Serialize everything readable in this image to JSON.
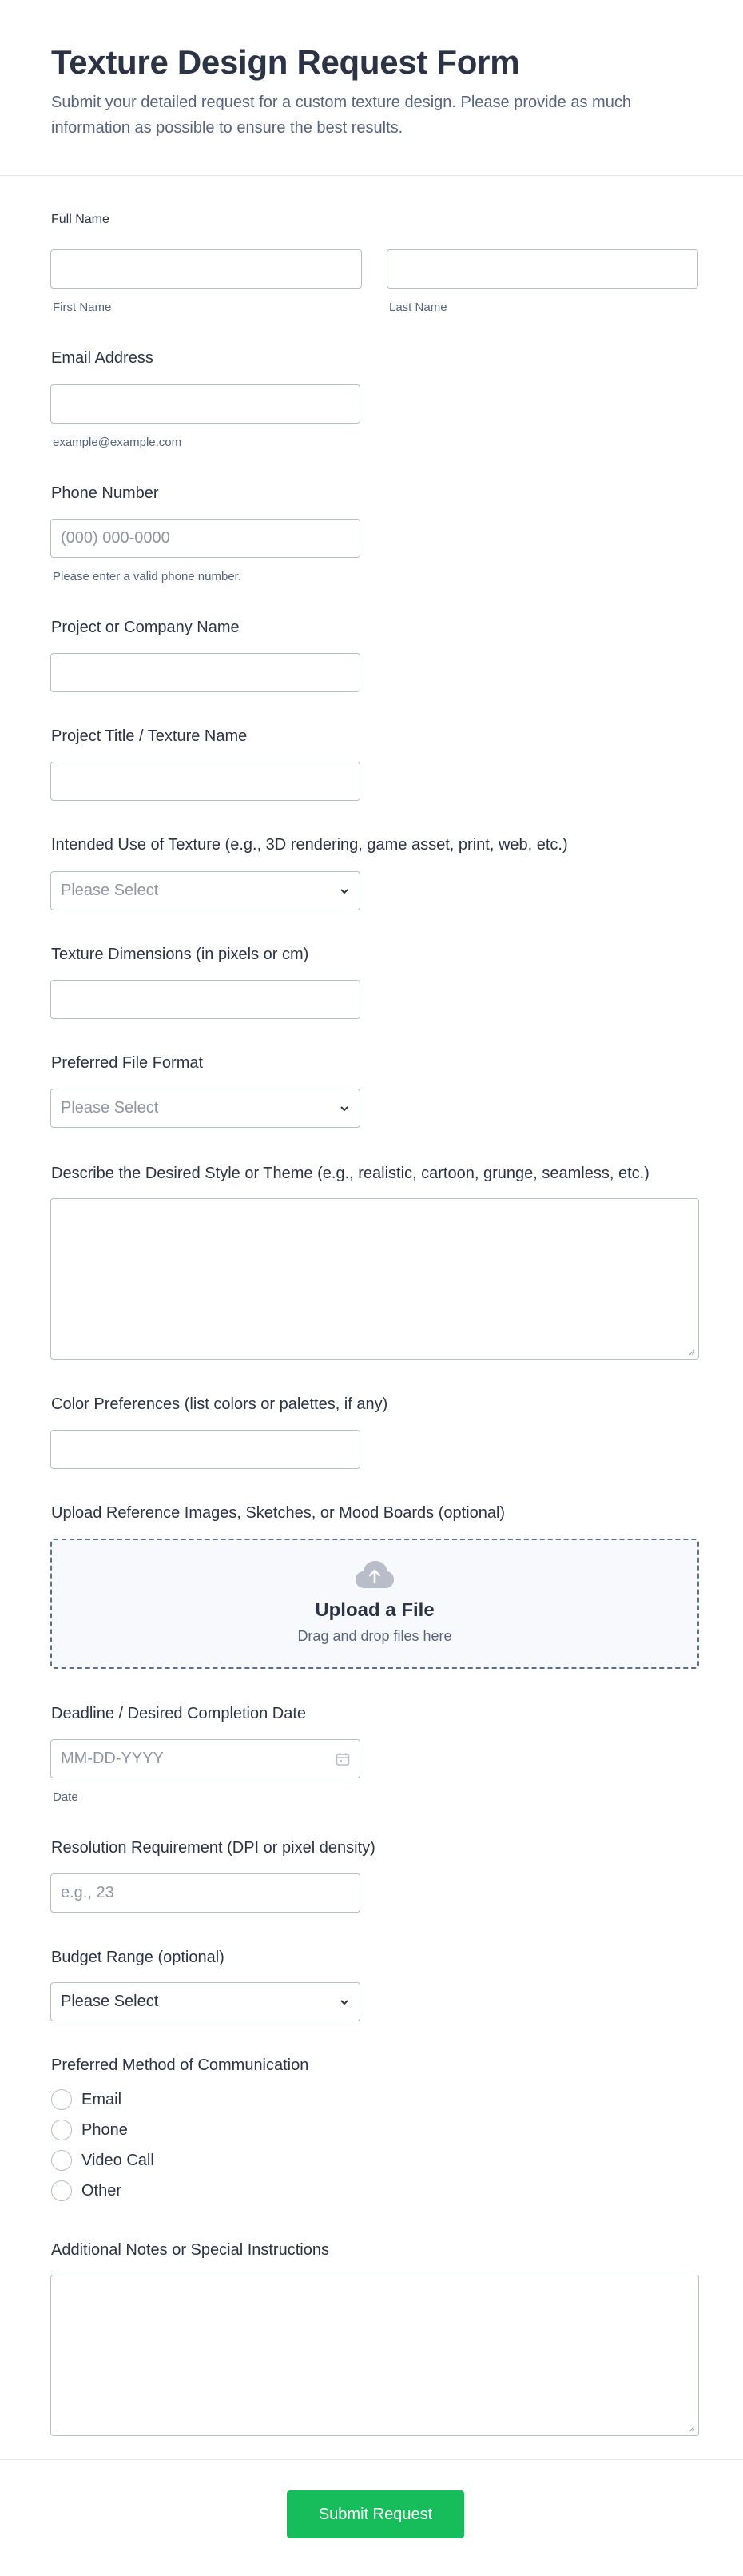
{
  "form": {
    "title": "Texture Design Request Form",
    "description": "Submit your detailed request for a custom texture design. Please provide as much information as possible to ensure the best results."
  },
  "full_name": {
    "label": "Full Name",
    "first_sub": "First Name",
    "last_sub": "Last Name",
    "first_value": "",
    "last_value": ""
  },
  "email": {
    "label": "Email Address",
    "sub": "example@example.com",
    "value": ""
  },
  "phone": {
    "label": "Phone Number",
    "placeholder": "(000) 000-0000",
    "sub": "Please enter a valid phone number."
  },
  "company": {
    "label": "Project or Company Name",
    "value": ""
  },
  "project_title": {
    "label": "Project Title / Texture Name",
    "value": ""
  },
  "intended_use": {
    "label": "Intended Use of Texture (e.g., 3D rendering, game asset, print, web, etc.)",
    "selected": "Please Select"
  },
  "dimensions": {
    "label": "Texture Dimensions (in pixels or cm)",
    "value": ""
  },
  "file_format": {
    "label": "Preferred File Format",
    "selected": "Please Select"
  },
  "style": {
    "label": "Describe the Desired Style or Theme (e.g., realistic, cartoon, grunge, seamless, etc.)",
    "value": ""
  },
  "colors": {
    "label": "Color Preferences (list colors or palettes, if any)",
    "value": ""
  },
  "upload": {
    "label": "Upload Reference Images, Sketches, or Mood Boards (optional)",
    "title": "Upload a File",
    "hint": "Drag and drop files here",
    "icon": "cloud-upload-icon"
  },
  "deadline": {
    "label": "Deadline / Desired Completion Date",
    "placeholder": "MM-DD-YYYY",
    "sub": "Date",
    "icon": "calendar-icon"
  },
  "resolution": {
    "label": "Resolution Requirement (DPI or pixel density)",
    "placeholder": "e.g., 23"
  },
  "budget": {
    "label": "Budget Range (optional)",
    "selected": "Please Select"
  },
  "communication": {
    "label": "Preferred Method of Communication",
    "options": [
      "Email",
      "Phone",
      "Video Call",
      "Other"
    ]
  },
  "notes": {
    "label": "Additional Notes or Special Instructions",
    "value": ""
  },
  "submit_label": "Submit Request",
  "colors_theme": {
    "accent": "#18bd5b",
    "text": "#2c3345",
    "muted": "#57647e",
    "border": "#b8bdc9"
  }
}
